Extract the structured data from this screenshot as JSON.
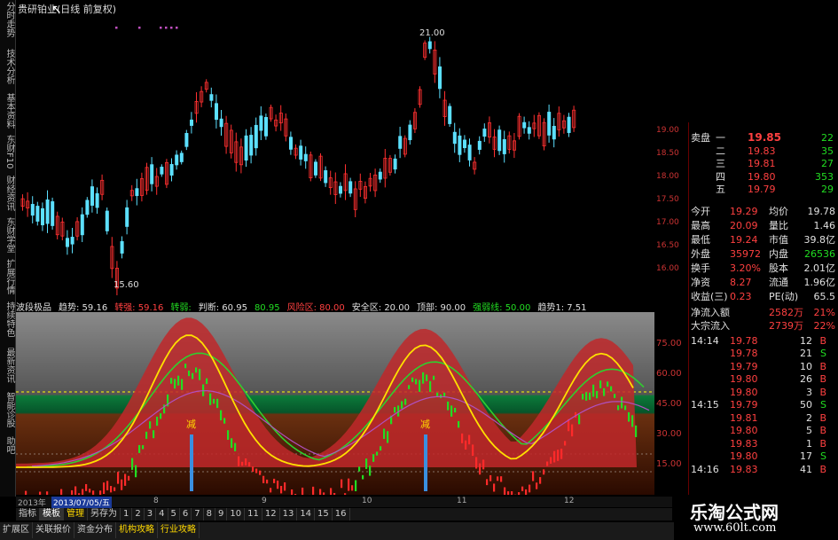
{
  "title": "贵研铂业(日线 前复权)",
  "side_tabs": [
    "分时走势",
    "技术分析",
    "基本资料",
    "东财F10",
    "财经资讯",
    "东财学堂",
    "扩展行情"
  ],
  "side_tabs_lower": [
    "持续特色",
    "最新资讯",
    "智能诊股",
    "助吧"
  ],
  "main_chart": {
    "high_label": "21.00",
    "low_label": "15.60",
    "price_scale": [
      "19.00",
      "18.50",
      "18.00",
      "17.50",
      "17.00",
      "16.50",
      "16.00"
    ]
  },
  "indicator_bar": [
    {
      "label": "波段极品",
      "color": "#e0e0e0"
    },
    {
      "label": "趋势: 59.16",
      "color": "#e0e0e0"
    },
    {
      "label": "转强: 59.16",
      "color": "#ff4040"
    },
    {
      "label": "转弱:",
      "color": "#22dd22"
    },
    {
      "label": "判断: 60.95",
      "color": "#e0e0e0"
    },
    {
      "label": "80.95",
      "color": "#22dd22"
    },
    {
      "label": "风险区: 80.00",
      "color": "#ff4040"
    },
    {
      "label": "安全区: 20.00",
      "color": "#e0e0e0"
    },
    {
      "label": "顶部: 90.00",
      "color": "#e0e0e0"
    },
    {
      "label": "强弱线: 50.00",
      "color": "#22dd22"
    },
    {
      "label": "趋势1: 7.51",
      "color": "#e0e0e0"
    }
  ],
  "indicator": {
    "scale": [
      "75.00",
      "60.00",
      "45.00",
      "30.00",
      "15.00"
    ],
    "sell_marks": [
      "减",
      "减"
    ]
  },
  "quote_panel": {
    "asks": [
      {
        "name": "卖盘",
        "level": "一",
        "price": "19.85",
        "vol": "22"
      },
      {
        "name": "",
        "level": "二",
        "price": "19.83",
        "vol": "35"
      },
      {
        "name": "",
        "level": "三",
        "price": "19.81",
        "vol": "27"
      },
      {
        "name": "",
        "level": "四",
        "price": "19.80",
        "vol": "353"
      },
      {
        "name": "",
        "level": "五",
        "price": "19.79",
        "vol": "29"
      }
    ],
    "stats": [
      [
        "今开",
        "19.29",
        "均价",
        "19.78"
      ],
      [
        "最高",
        "20.09",
        "量比",
        "1.46"
      ],
      [
        "最低",
        "19.24",
        "市值",
        "39.8亿"
      ],
      [
        "外盘",
        "35972",
        "内盘",
        "26536"
      ],
      [
        "换手",
        "3.20%",
        "股本",
        "2.01亿"
      ],
      [
        "净资",
        "8.27",
        "流通",
        "1.96亿"
      ],
      [
        "收益(三)",
        "0.23",
        "PE(动)",
        "65.5"
      ]
    ],
    "flows": [
      [
        "净流入额",
        "2582万",
        "21%"
      ],
      [
        "大宗流入",
        "2739万",
        "22%"
      ]
    ],
    "ticks": [
      [
        "14:14",
        "19.78",
        "12",
        "B"
      ],
      [
        "",
        "19.78",
        "21",
        "S"
      ],
      [
        "",
        "19.79",
        "10",
        "B"
      ],
      [
        "",
        "19.80",
        "26",
        "B"
      ],
      [
        "",
        "19.80",
        "3",
        "B"
      ],
      [
        "14:15",
        "19.79",
        "50",
        "S"
      ],
      [
        "",
        "19.81",
        "2",
        "B"
      ],
      [
        "",
        "19.80",
        "5",
        "B"
      ],
      [
        "",
        "19.83",
        "1",
        "B"
      ],
      [
        "",
        "19.80",
        "17",
        "S"
      ],
      [
        "14:16",
        "19.83",
        "41",
        "B"
      ]
    ]
  },
  "date_bar": {
    "year": "2013年",
    "date": "2013/07/05/五",
    "months": [
      "8",
      "9",
      "10",
      "11",
      "12"
    ]
  },
  "toolbar": [
    "指标",
    "模板",
    "管理",
    "另存为",
    "1",
    "2",
    "3",
    "4",
    "5",
    "6",
    "7",
    "8",
    "9",
    "10",
    "11",
    "12",
    "13",
    "14",
    "15",
    "16"
  ],
  "toolbar2": [
    "扩展区",
    "关联报价",
    "资金分布",
    "机构攻略",
    "行业攻略"
  ],
  "brand": {
    "name": "乐淘公式网",
    "url": "www.60lt.com"
  }
}
